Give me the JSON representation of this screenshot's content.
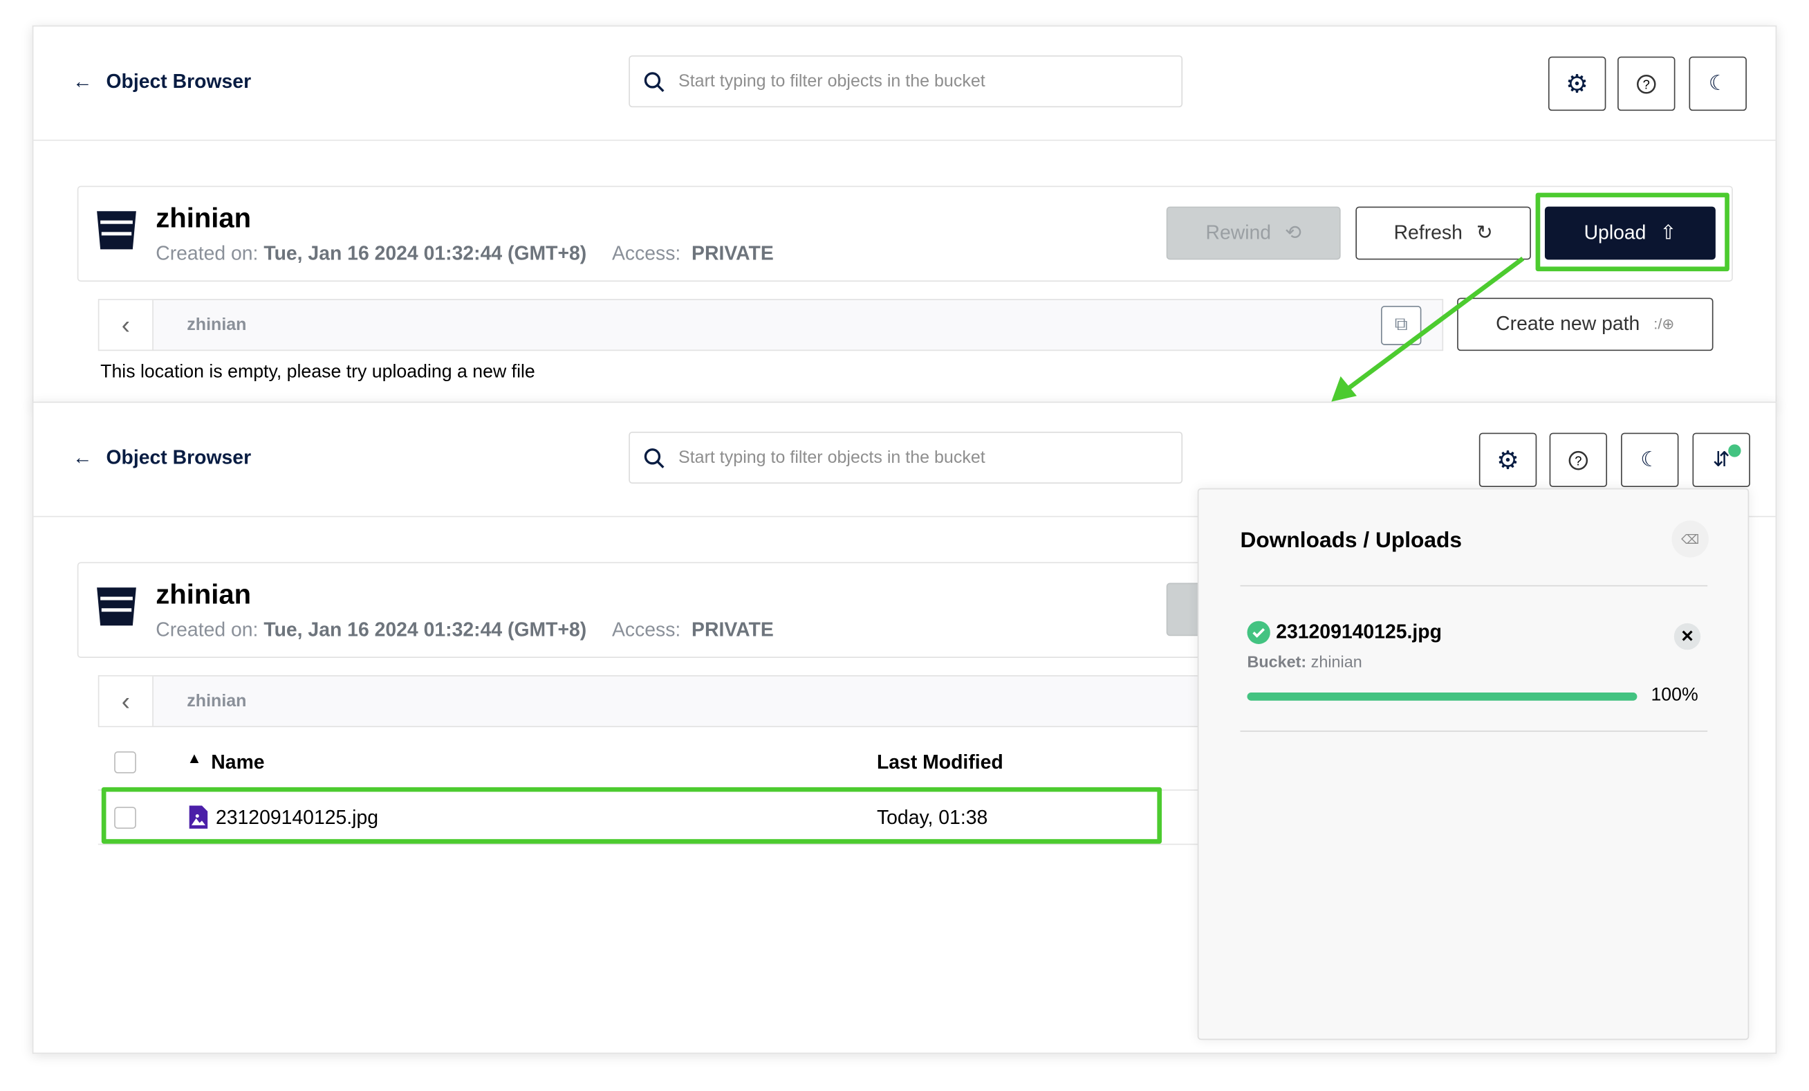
{
  "colors": {
    "accent_dark": "#0b1530",
    "success": "#43c381",
    "highlight": "#4ccb2f",
    "file_icon": "#4b1fa8"
  },
  "top": {
    "header": {
      "back_label": "Object Browser",
      "search_placeholder": "Start typing to filter objects in the bucket",
      "icons": [
        "gear-icon",
        "help-icon",
        "moon-icon"
      ]
    },
    "bucket": {
      "name": "zhinian",
      "created_label": "Created on:",
      "created_value": "Tue, Jan 16 2024 01:32:44 (GMT+8)",
      "access_label": "Access:",
      "access_value": "PRIVATE"
    },
    "buttons": {
      "rewind": "Rewind",
      "refresh": "Refresh",
      "upload": "Upload",
      "create_path": "Create new path"
    },
    "breadcrumb": "zhinian",
    "empty_message": "This location is empty, please try uploading a new file"
  },
  "bottom": {
    "header": {
      "back_label": "Object Browser",
      "search_placeholder": "Start typing to filter objects in the bucket",
      "icons": [
        "gear-icon",
        "help-icon",
        "moon-icon",
        "download-upload-icon"
      ]
    },
    "bucket": {
      "name": "zhinian",
      "created_label": "Created on:",
      "created_value": "Tue, Jan 16 2024 01:32:44 (GMT+8)",
      "access_label": "Access:",
      "access_value": "PRIVATE"
    },
    "breadcrumb": "zhinian",
    "table": {
      "columns": [
        "Name",
        "Last Modified"
      ],
      "rows": [
        {
          "name": "231209140125.jpg",
          "modified": "Today, 01:38"
        }
      ]
    },
    "transfers": {
      "title": "Downloads / Uploads",
      "items": [
        {
          "file": "231209140125.jpg",
          "bucket_label": "Bucket:",
          "bucket": "zhinian",
          "progress_percent": 100,
          "progress_text": "100%",
          "status": "complete"
        }
      ]
    }
  }
}
